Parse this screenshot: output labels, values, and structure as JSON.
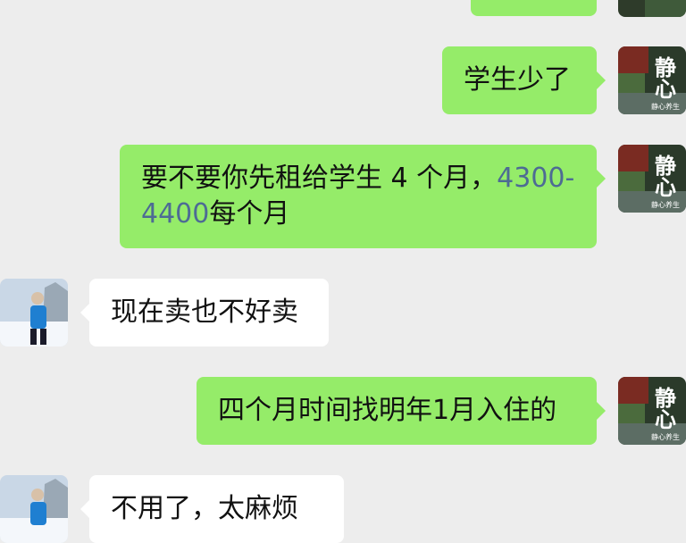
{
  "chat": {
    "my_avatar": {
      "big_text_1": "静",
      "big_text_2": "心",
      "small_text": "静心养生"
    },
    "messages": [
      {
        "side": "out",
        "text": ""
      },
      {
        "side": "out",
        "text": "学生少了"
      },
      {
        "side": "out",
        "line1_a": "要不要你先租给学生 4 个月，",
        "line1_b": "4300-",
        "line2_a": "4400",
        "line2_b": "每个月"
      },
      {
        "side": "in",
        "text": "现在卖也不好卖"
      },
      {
        "side": "out",
        "text": "四个月时间找明年1月入住的"
      },
      {
        "side": "in",
        "text": "不用了，太麻烦"
      }
    ]
  }
}
